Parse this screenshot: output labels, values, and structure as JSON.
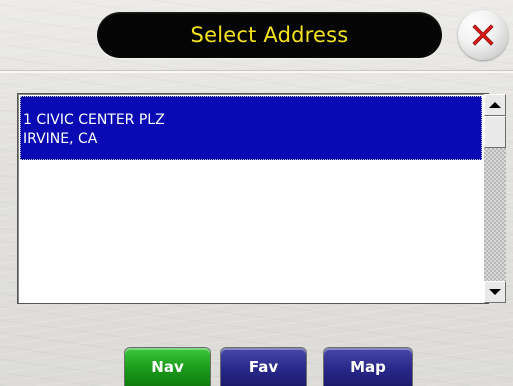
{
  "header": {
    "title": "Select Address",
    "close_icon": "close-x-icon",
    "accent_title_color": "#f3e21d",
    "close_icon_color": "#e01818"
  },
  "address_list": {
    "items": [
      {
        "line1": "1 CIVIC CENTER PLZ",
        "line2": "IRVINE, CA",
        "selected": true
      }
    ],
    "selection_color": "#0a0ab4"
  },
  "scrollbar": {
    "up_icon": "arrow-up-icon",
    "down_icon": "arrow-down-icon"
  },
  "bottom_bar": {
    "nav_label": "Nav",
    "fav_label": "Fav",
    "map_label": "Map",
    "nav_color": "#1a9a1a",
    "fav_color": "#28288a",
    "map_color": "#28288a"
  }
}
